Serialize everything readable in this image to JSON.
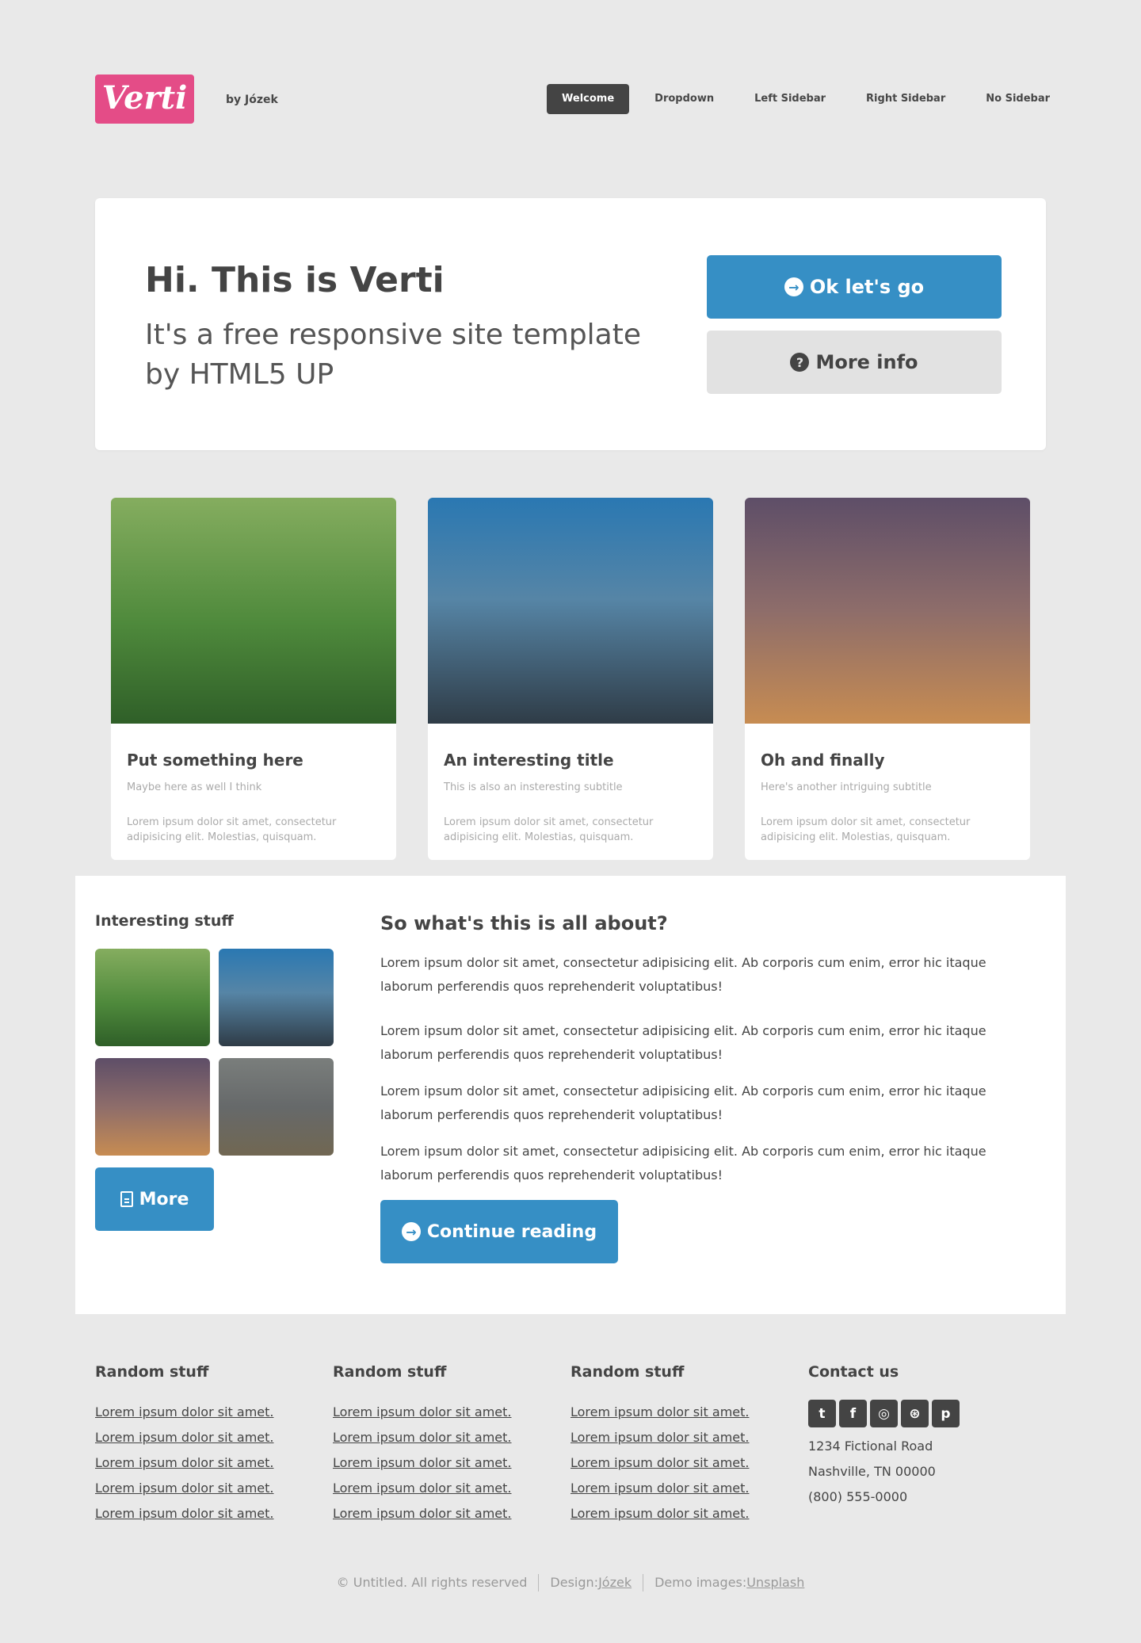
{
  "header": {
    "logo": "Verti",
    "byline": "by Józek",
    "nav": [
      "Welcome",
      "Dropdown",
      "Left Sidebar",
      "Right Sidebar",
      "No Sidebar"
    ]
  },
  "banner": {
    "title": "Hi. This is Verti",
    "subtitle": "It's a free responsive site template by HTML5 UP",
    "primary_button": "Ok let's go",
    "secondary_button": "More info"
  },
  "features": [
    {
      "title": "Put something here",
      "subtitle": "Maybe here as well I think",
      "text": "Lorem ipsum dolor sit amet, consectetur adipisicing elit. Molestias, quisquam."
    },
    {
      "title": "An interesting title",
      "subtitle": "This is also an insteresting subtitle",
      "text": "Lorem ipsum dolor sit amet, consectetur adipisicing elit. Molestias, quisquam."
    },
    {
      "title": "Oh and finally",
      "subtitle": "Here's another intriguing subtitle",
      "text": "Lorem ipsum dolor sit amet, consectetur adipisicing elit. Molestias, quisquam."
    }
  ],
  "sidebar": {
    "title": "Interesting stuff",
    "more_button": "More"
  },
  "content": {
    "title": "So what's this is all about?",
    "paragraphs": [
      "Lorem ipsum dolor sit amet, consectetur adipisicing elit. Ab corporis cum enim, error hic itaque laborum perferendis quos reprehenderit voluptatibus!",
      "Lorem ipsum dolor sit amet, consectetur adipisicing elit. Ab corporis cum enim, error hic itaque laborum perferendis quos reprehenderit voluptatibus!",
      "Lorem ipsum dolor sit amet, consectetur adipisicing elit. Ab corporis cum enim, error hic itaque laborum perferendis quos reprehenderit voluptatibus!",
      "Lorem ipsum dolor sit amet, consectetur adipisicing elit. Ab corporis cum enim, error hic itaque laborum perferendis quos reprehenderit voluptatibus!"
    ],
    "continue_button": "Continue reading"
  },
  "footer": {
    "columns": [
      {
        "title": "Random stuff",
        "links": [
          "Lorem ipsum dolor sit amet.",
          "Lorem ipsum dolor sit amet.",
          "Lorem ipsum dolor sit amet.",
          "Lorem ipsum dolor sit amet.",
          "Lorem ipsum dolor sit amet."
        ]
      },
      {
        "title": "Random stuff",
        "links": [
          "Lorem ipsum dolor sit amet.",
          "Lorem ipsum dolor sit amet.",
          "Lorem ipsum dolor sit amet.",
          "Lorem ipsum dolor sit amet.",
          "Lorem ipsum dolor sit amet."
        ]
      },
      {
        "title": "Random stuff",
        "links": [
          "Lorem ipsum dolor sit amet.",
          "Lorem ipsum dolor sit amet.",
          "Lorem ipsum dolor sit amet.",
          "Lorem ipsum dolor sit amet.",
          "Lorem ipsum dolor sit amet."
        ]
      }
    ],
    "contact": {
      "title": "Contact us",
      "social_icons": [
        "twitter-icon",
        "facebook-icon",
        "instagram-icon",
        "dribbble-icon",
        "pinterest-icon"
      ],
      "address_line1": "1234 Fictional Road",
      "address_line2": "Nashville, TN 00000",
      "phone": "(800) 555-0000"
    }
  },
  "copyright": {
    "text": "© Untitled. All rights reserved",
    "design_label": "Design: ",
    "design_link": "Józek",
    "images_label": "Demo images: ",
    "images_link": "Unsplash"
  },
  "colors": {
    "logo": "#e44c87",
    "accent_blue": "#368fc5",
    "background": "#e9e9e9",
    "nav_active": "#444444"
  }
}
